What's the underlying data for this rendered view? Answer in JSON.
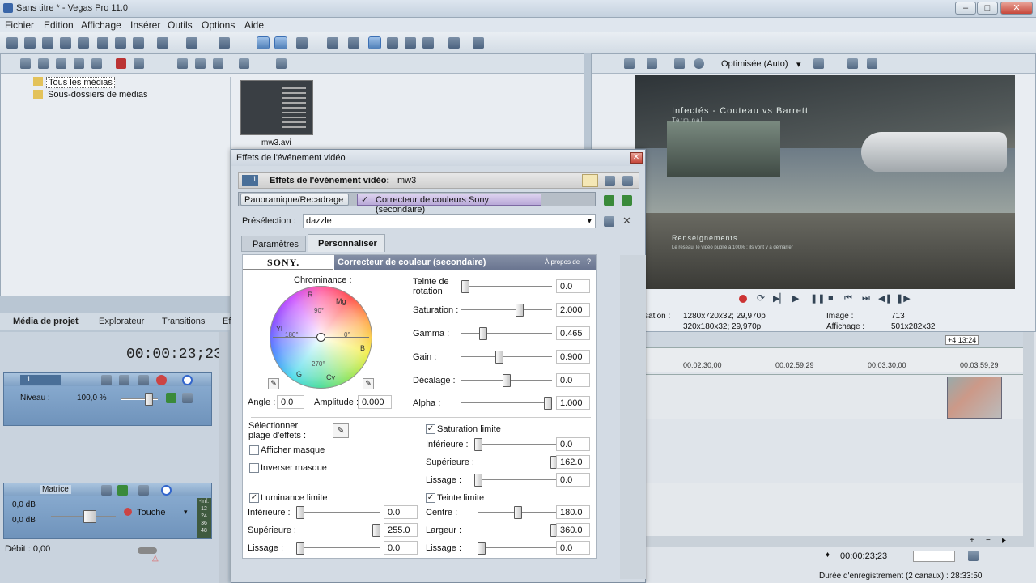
{
  "app": {
    "window_title": "Sans titre * - Vegas Pro 11.0"
  },
  "menu": [
    "Fichier",
    "Edition",
    "Affichage",
    "Insérer",
    "Outils",
    "Options",
    "Aide"
  ],
  "media": {
    "tree": [
      "Tous les médias",
      "Sous-dossiers de médias"
    ],
    "thumb_label": "mw3.avi",
    "tabs": [
      "Média de projet",
      "Explorateur",
      "Transitions",
      "Eff"
    ]
  },
  "preview": {
    "quality": "Optimisée (Auto)",
    "video_title": "Infectés - Couteau vs Barrett",
    "video_sub": "Terminal",
    "video_caption": "Renseignements",
    "video_caption2": "Le reseau, le vidéo publié à 100% ; ils vont y a démarrer",
    "info": {
      "projet_label": "",
      "projet_val": "1280x720x32; 29,970p",
      "prev_label": "alisation :",
      "prev_val": "320x180x32; 29,970p",
      "image_label": "Image :",
      "image_val": "713",
      "aff_label": "Affichage :",
      "aff_val": "501x282x32"
    }
  },
  "timeline": {
    "timecode": "00:00:23;23",
    "marker": "+4:13:24",
    "ruler": [
      "00:02:30;00",
      "00:02:59;29",
      "00:03:30;00",
      "00:03:59;29"
    ],
    "track1_num": "1",
    "track1_level_label": "Niveau :",
    "track1_level_val": "100,0 %",
    "track2_name": "Matrice",
    "track2_db1": "0,0 dB",
    "track2_db2": "0,0 dB",
    "track2_touch": "Touche",
    "track2_meter": [
      "-Inf.",
      "12",
      "24",
      "36",
      "48"
    ],
    "debit": "Débit : 0,00",
    "status_time": "00:00:23;23",
    "status_rec": "Durée d'enregistrement (2 canaux) : 28:33:50"
  },
  "dialog": {
    "title": "Effets de l'événement vidéo",
    "header_label": "Effets de l'événement vidéo:",
    "header_event": "mw3",
    "chain_num": "1",
    "chain": [
      "Panoramique/Recadrage",
      "Correcteur de couleurs Sony (secondaire)"
    ],
    "preset_label": "Présélection :",
    "preset_value": "dazzle",
    "tabs": [
      "Paramètres",
      "Personnaliser"
    ],
    "sony_logo": "SONY.",
    "plugin_name": "Correcteur de couleur (secondaire)",
    "about": "À propos de",
    "about_q": "?",
    "chrominance_label": "Chrominance :",
    "wheel_labels": {
      "R": "R",
      "Mg": "Mg",
      "B": "B",
      "Cy": "Cy",
      "G": "G",
      "Yl": "Yl",
      "d90": "90°",
      "d0": "0°",
      "d180": "180°",
      "d270": "270°"
    },
    "angle_label": "Angle :",
    "angle_val": "0.0",
    "amplitude_label": "Amplitude :",
    "amplitude_val": "0.000",
    "sliders": [
      {
        "label": "Teinte de rotation",
        "value": "0.0",
        "pos": 0.0
      },
      {
        "label": "Saturation :",
        "value": "2.000",
        "pos": 0.66
      },
      {
        "label": "Gamma :",
        "value": "0.465",
        "pos": 0.22
      },
      {
        "label": "Gain :",
        "value": "0.900",
        "pos": 0.41
      },
      {
        "label": "Décalage :",
        "value": "0.0",
        "pos": 0.5
      },
      {
        "label": "Alpha :",
        "value": "1.000",
        "pos": 1.0
      }
    ],
    "select_range_label": "Sélectionner plage d'effets :",
    "show_mask": "Afficher masque",
    "invert_mask": "Inverser masque",
    "luminance": {
      "label": "Luminance limite",
      "checked": true,
      "rows": [
        {
          "label": "Inférieure :",
          "value": "0.0",
          "pos": 0.0
        },
        {
          "label": "Supérieure :",
          "value": "255.0",
          "pos": 1.0
        },
        {
          "label": "Lissage :",
          "value": "0.0",
          "pos": 0.0
        }
      ]
    },
    "saturation": {
      "label": "Saturation limite",
      "checked": true,
      "rows": [
        {
          "label": "Inférieure :",
          "value": "0.0",
          "pos": 0.0
        },
        {
          "label": "Supérieure :",
          "value": "162.0",
          "pos": 1.0
        },
        {
          "label": "Lissage :",
          "value": "0.0",
          "pos": 0.0
        }
      ]
    },
    "hue": {
      "label": "Teinte limite",
      "checked": true,
      "rows": [
        {
          "label": "Centre :",
          "value": "180.0",
          "pos": 0.5
        },
        {
          "label": "Largeur :",
          "value": "360.0",
          "pos": 1.0
        },
        {
          "label": "Lissage :",
          "value": "0.0",
          "pos": 0.0
        }
      ]
    }
  }
}
